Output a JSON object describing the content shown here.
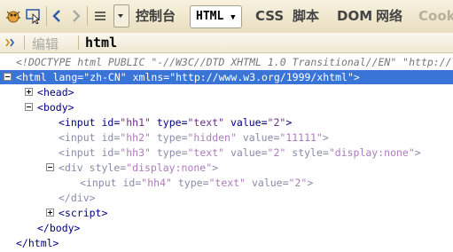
{
  "toolbar": {
    "icons": [
      "firebug-icon",
      "inspect-icon",
      "back-icon",
      "forward-icon",
      "menu-icon",
      "dropdown-icon"
    ],
    "tabs": {
      "console": "控制台",
      "html": "HTML",
      "css": "CSS",
      "script": "脚本",
      "dom": "DOM",
      "net": "网络",
      "cookies": "Cook"
    },
    "accent": "#3875d7"
  },
  "bar": {
    "edit_label": "编辑",
    "breadcrumb": "html"
  },
  "tree": {
    "doctype": "<!DOCTYPE html PUBLIC \"-//W3C//DTD XHTML 1.0 Transitional//EN\" \"http://",
    "html_open": {
      "tag": "html",
      "attrs": [
        {
          "name": "lang",
          "value": "\"zh-CN\""
        },
        {
          "name": "xmlns",
          "value": "\"http://www.w3.org/1999/xhtml\""
        }
      ]
    },
    "head": "head",
    "body": "body",
    "input1": {
      "tag": "input",
      "attrs": [
        {
          "name": "id",
          "value": "\"hh1\""
        },
        {
          "name": "type",
          "value": "\"text\""
        },
        {
          "name": "value",
          "value": "\"2\""
        }
      ]
    },
    "input2": {
      "tag": "input",
      "attrs": [
        {
          "name": "id",
          "value": "\"hh2\""
        },
        {
          "name": "type",
          "value": "\"hidden\""
        },
        {
          "name": "value",
          "value": "\"11111\""
        }
      ]
    },
    "input3": {
      "tag": "input",
      "attrs": [
        {
          "name": "id",
          "value": "\"hh3\""
        },
        {
          "name": "type",
          "value": "\"text\""
        },
        {
          "name": "value",
          "value": "\"2\""
        },
        {
          "name": "style",
          "value": "\"display:none\""
        }
      ]
    },
    "div_open": {
      "tag": "div",
      "attrs": [
        {
          "name": "style",
          "value": "\"display:none\""
        }
      ]
    },
    "input4": {
      "tag": "input",
      "attrs": [
        {
          "name": "id",
          "value": "\"hh4\""
        },
        {
          "name": "type",
          "value": "\"text\""
        },
        {
          "name": "value",
          "value": "\"2\""
        }
      ]
    },
    "div_close": "</div>",
    "script": "script",
    "body_close": "</body>",
    "html_close": "</html>"
  }
}
